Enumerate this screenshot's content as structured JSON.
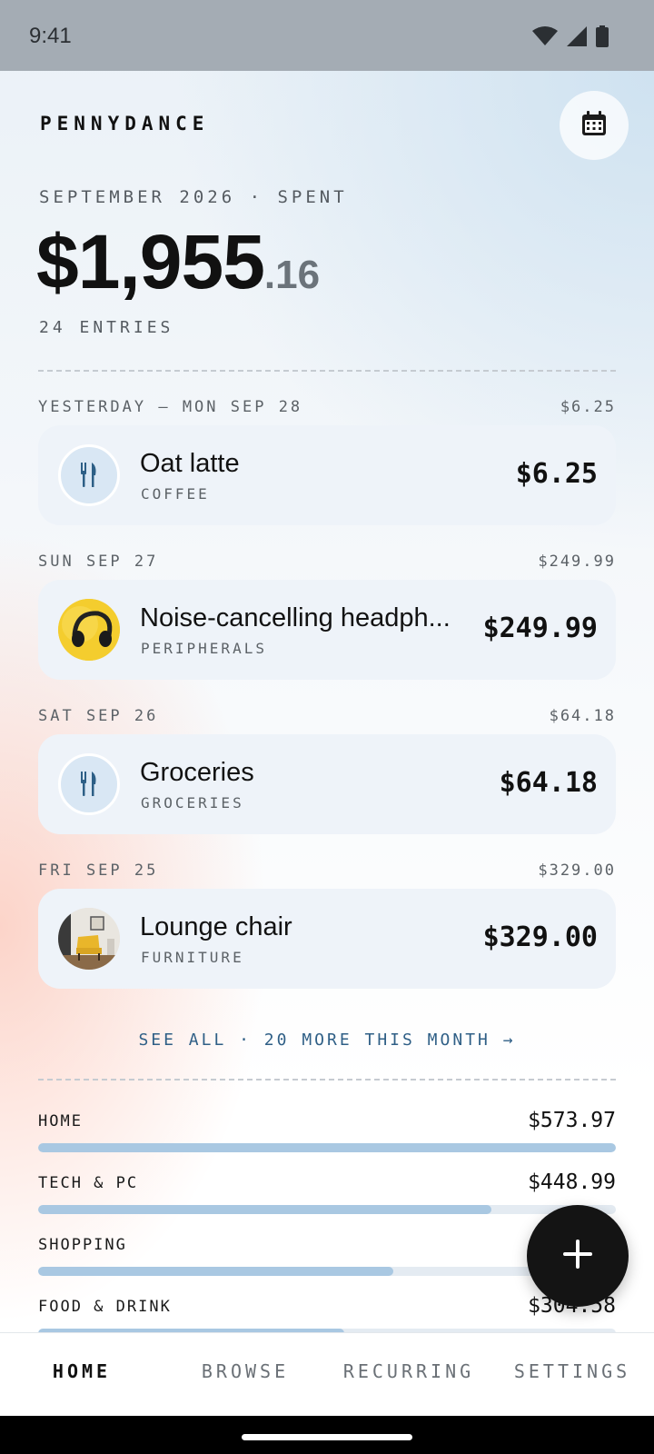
{
  "status": {
    "time": "9:41"
  },
  "app": {
    "title": "PENNYDANCE"
  },
  "summary": {
    "period": "SEPTEMBER 2026 · SPENT",
    "total_main": "$1,955",
    "total_cents": ".16",
    "entries": "24 ENTRIES"
  },
  "days": [
    {
      "date": "YESTERDAY — MON SEP 28",
      "day_total": "$6.25",
      "item": {
        "name": "Oat latte",
        "category": "COFFEE",
        "amount": "$6.25",
        "icon": "fork-knife-icon"
      }
    },
    {
      "date": "SUN SEP 27",
      "day_total": "$249.99",
      "item": {
        "name": "Noise-cancelling headph...",
        "category": "PERIPHERALS",
        "amount": "$249.99",
        "icon": "headphones-photo"
      }
    },
    {
      "date": "SAT SEP 26",
      "day_total": "$64.18",
      "item": {
        "name": "Groceries",
        "category": "GROCERIES",
        "amount": "$64.18",
        "icon": "fork-knife-icon"
      }
    },
    {
      "date": "FRI SEP 25",
      "day_total": "$329.00",
      "item": {
        "name": "Lounge chair",
        "category": "FURNITURE",
        "amount": "$329.00",
        "icon": "chair-photo"
      }
    }
  ],
  "see_all": "SEE ALL · 20 MORE THIS MONTH →",
  "categories": [
    {
      "label": "HOME",
      "amount": "$573.97",
      "share": 1.0
    },
    {
      "label": "TECH & PC",
      "amount": "$448.99",
      "share": 0.784
    },
    {
      "label": "SHOPPING",
      "amount": "",
      "share": 0.615
    },
    {
      "label": "FOOD & DRINK",
      "amount": "$304.58",
      "share": 0.53
    }
  ],
  "nav": {
    "home": "HOME",
    "browse": "BROWSE",
    "recurring": "RECURRING",
    "settings": "SETTINGS",
    "active": "home"
  },
  "colors": {
    "accent": "#2f5f86",
    "bar": "#a9c8e2",
    "card": "#eef3f9",
    "fab": "#141414"
  }
}
